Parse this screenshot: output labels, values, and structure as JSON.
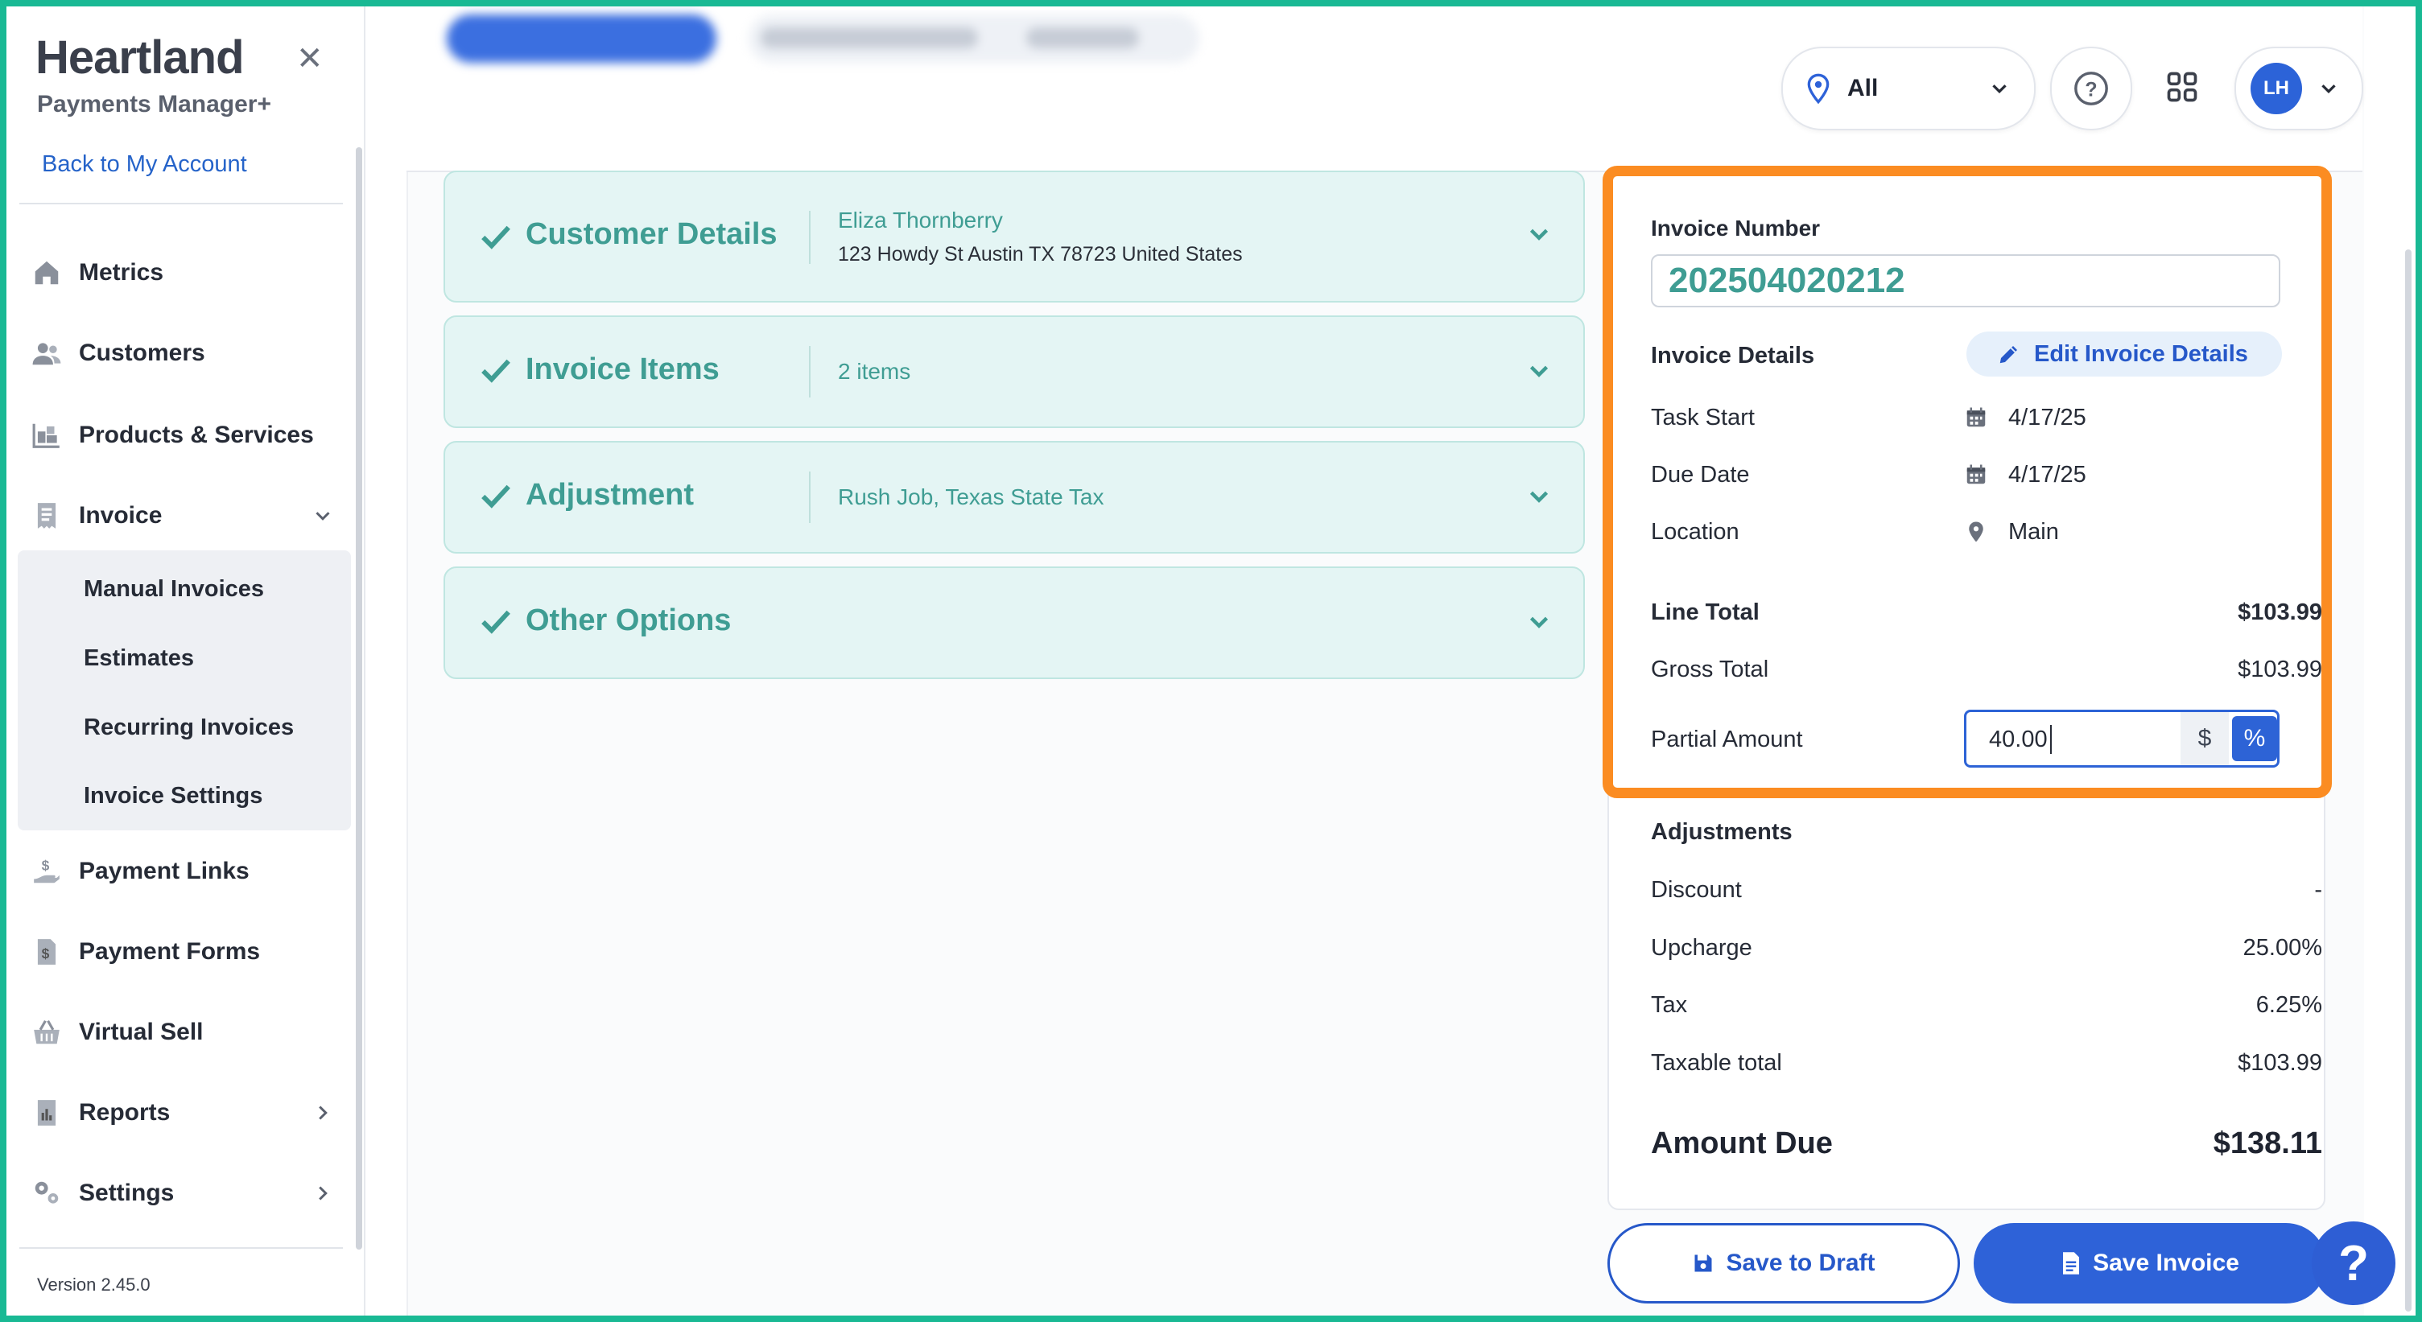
{
  "sidebar": {
    "brand": "Heartland",
    "brand_sub": "Payments Manager+",
    "close_glyph": "✕",
    "back_link": "Back to My Account",
    "items": [
      {
        "label": "Metrics",
        "icon": "home-icon"
      },
      {
        "label": "Customers",
        "icon": "users-icon"
      },
      {
        "label": "Products & Services",
        "icon": "boxes-icon"
      },
      {
        "label": "Invoice",
        "icon": "receipt-icon"
      },
      {
        "label": "Payment Links",
        "icon": "hand-dollar-icon"
      },
      {
        "label": "Payment Forms",
        "icon": "form-dollar-icon"
      },
      {
        "label": "Virtual Sell",
        "icon": "basket-icon"
      },
      {
        "label": "Reports",
        "icon": "report-icon"
      },
      {
        "label": "Settings",
        "icon": "gears-icon"
      }
    ],
    "invoice_sub": [
      "Manual Invoices",
      "Estimates",
      "Recurring Invoices",
      "Invoice Settings"
    ],
    "version": "Version 2.45.0"
  },
  "topbar": {
    "location_label": "All",
    "avatar_initials": "LH"
  },
  "sections": [
    {
      "title": "Customer Details",
      "summary": "Eliza Thornberry",
      "summary2": "123 Howdy St Austin TX 78723 United States"
    },
    {
      "title": "Invoice Items",
      "summary": "2 items"
    },
    {
      "title": "Adjustment",
      "summary": "Rush Job, Texas State Tax"
    },
    {
      "title": "Other Options",
      "summary": ""
    }
  ],
  "invoice": {
    "number_label": "Invoice Number",
    "number": "202504020212",
    "details_label": "Invoice Details",
    "edit_button": "Edit Invoice Details",
    "task_start_label": "Task Start",
    "task_start": "4/17/25",
    "due_date_label": "Due Date",
    "due_date": "4/17/25",
    "location_label": "Location",
    "location": "Main",
    "line_total_label": "Line Total",
    "line_total": "$103.99",
    "gross_total_label": "Gross Total",
    "gross_total": "$103.99",
    "partial_label": "Partial Amount",
    "partial_value": "40.00",
    "dollar_toggle": "$",
    "percent_toggle": "%",
    "adjustments_label": "Adjustments",
    "discount_label": "Discount",
    "discount": "-",
    "upcharge_label": "Upcharge",
    "upcharge": "25.00%",
    "tax_label": "Tax",
    "tax": "6.25%",
    "taxable_label": "Taxable total",
    "taxable": "$103.99",
    "amount_due_label": "Amount Due",
    "amount_due": "$138.11"
  },
  "actions": {
    "save_draft": "Save to Draft",
    "save_invoice": "Save Invoice",
    "help_glyph": "?"
  },
  "colors": {
    "accent_teal": "#3f9d93",
    "primary_blue": "#2e62d8",
    "highlight_orange": "#fb8c22",
    "frame_green": "#19b994"
  }
}
